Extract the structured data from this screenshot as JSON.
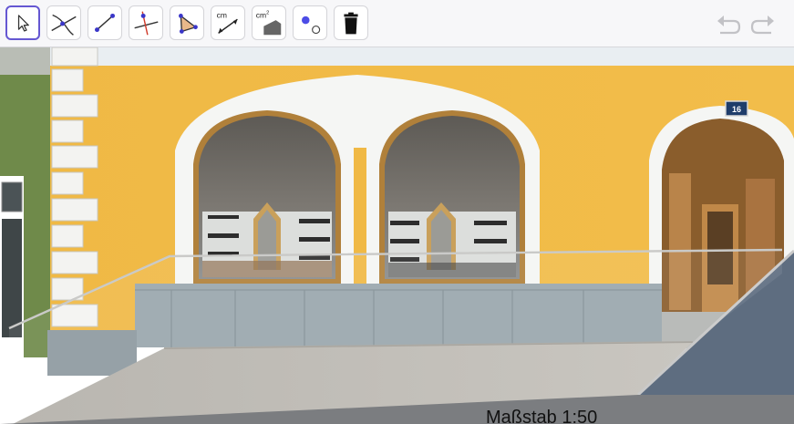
{
  "toolbar": {
    "tools": [
      {
        "name": "move",
        "selected": true
      },
      {
        "name": "intersect"
      },
      {
        "name": "segment"
      },
      {
        "name": "perpendicular-line"
      },
      {
        "name": "polygon"
      },
      {
        "name": "distance",
        "label": "cm"
      },
      {
        "name": "area",
        "label": "cm",
        "sup": "2"
      },
      {
        "name": "point-style"
      },
      {
        "name": "delete"
      }
    ],
    "distance_label": "cm",
    "area_label": "cm",
    "area_sup": "2"
  },
  "history": {
    "undo": "undo-icon",
    "redo": "redo-icon"
  },
  "graphics": {
    "scale_label": "Maßstab 1:50",
    "house_number": "16"
  },
  "colors": {
    "accent": "#6557d2",
    "wall": "#efb944",
    "stone": "#9aa7ad"
  }
}
